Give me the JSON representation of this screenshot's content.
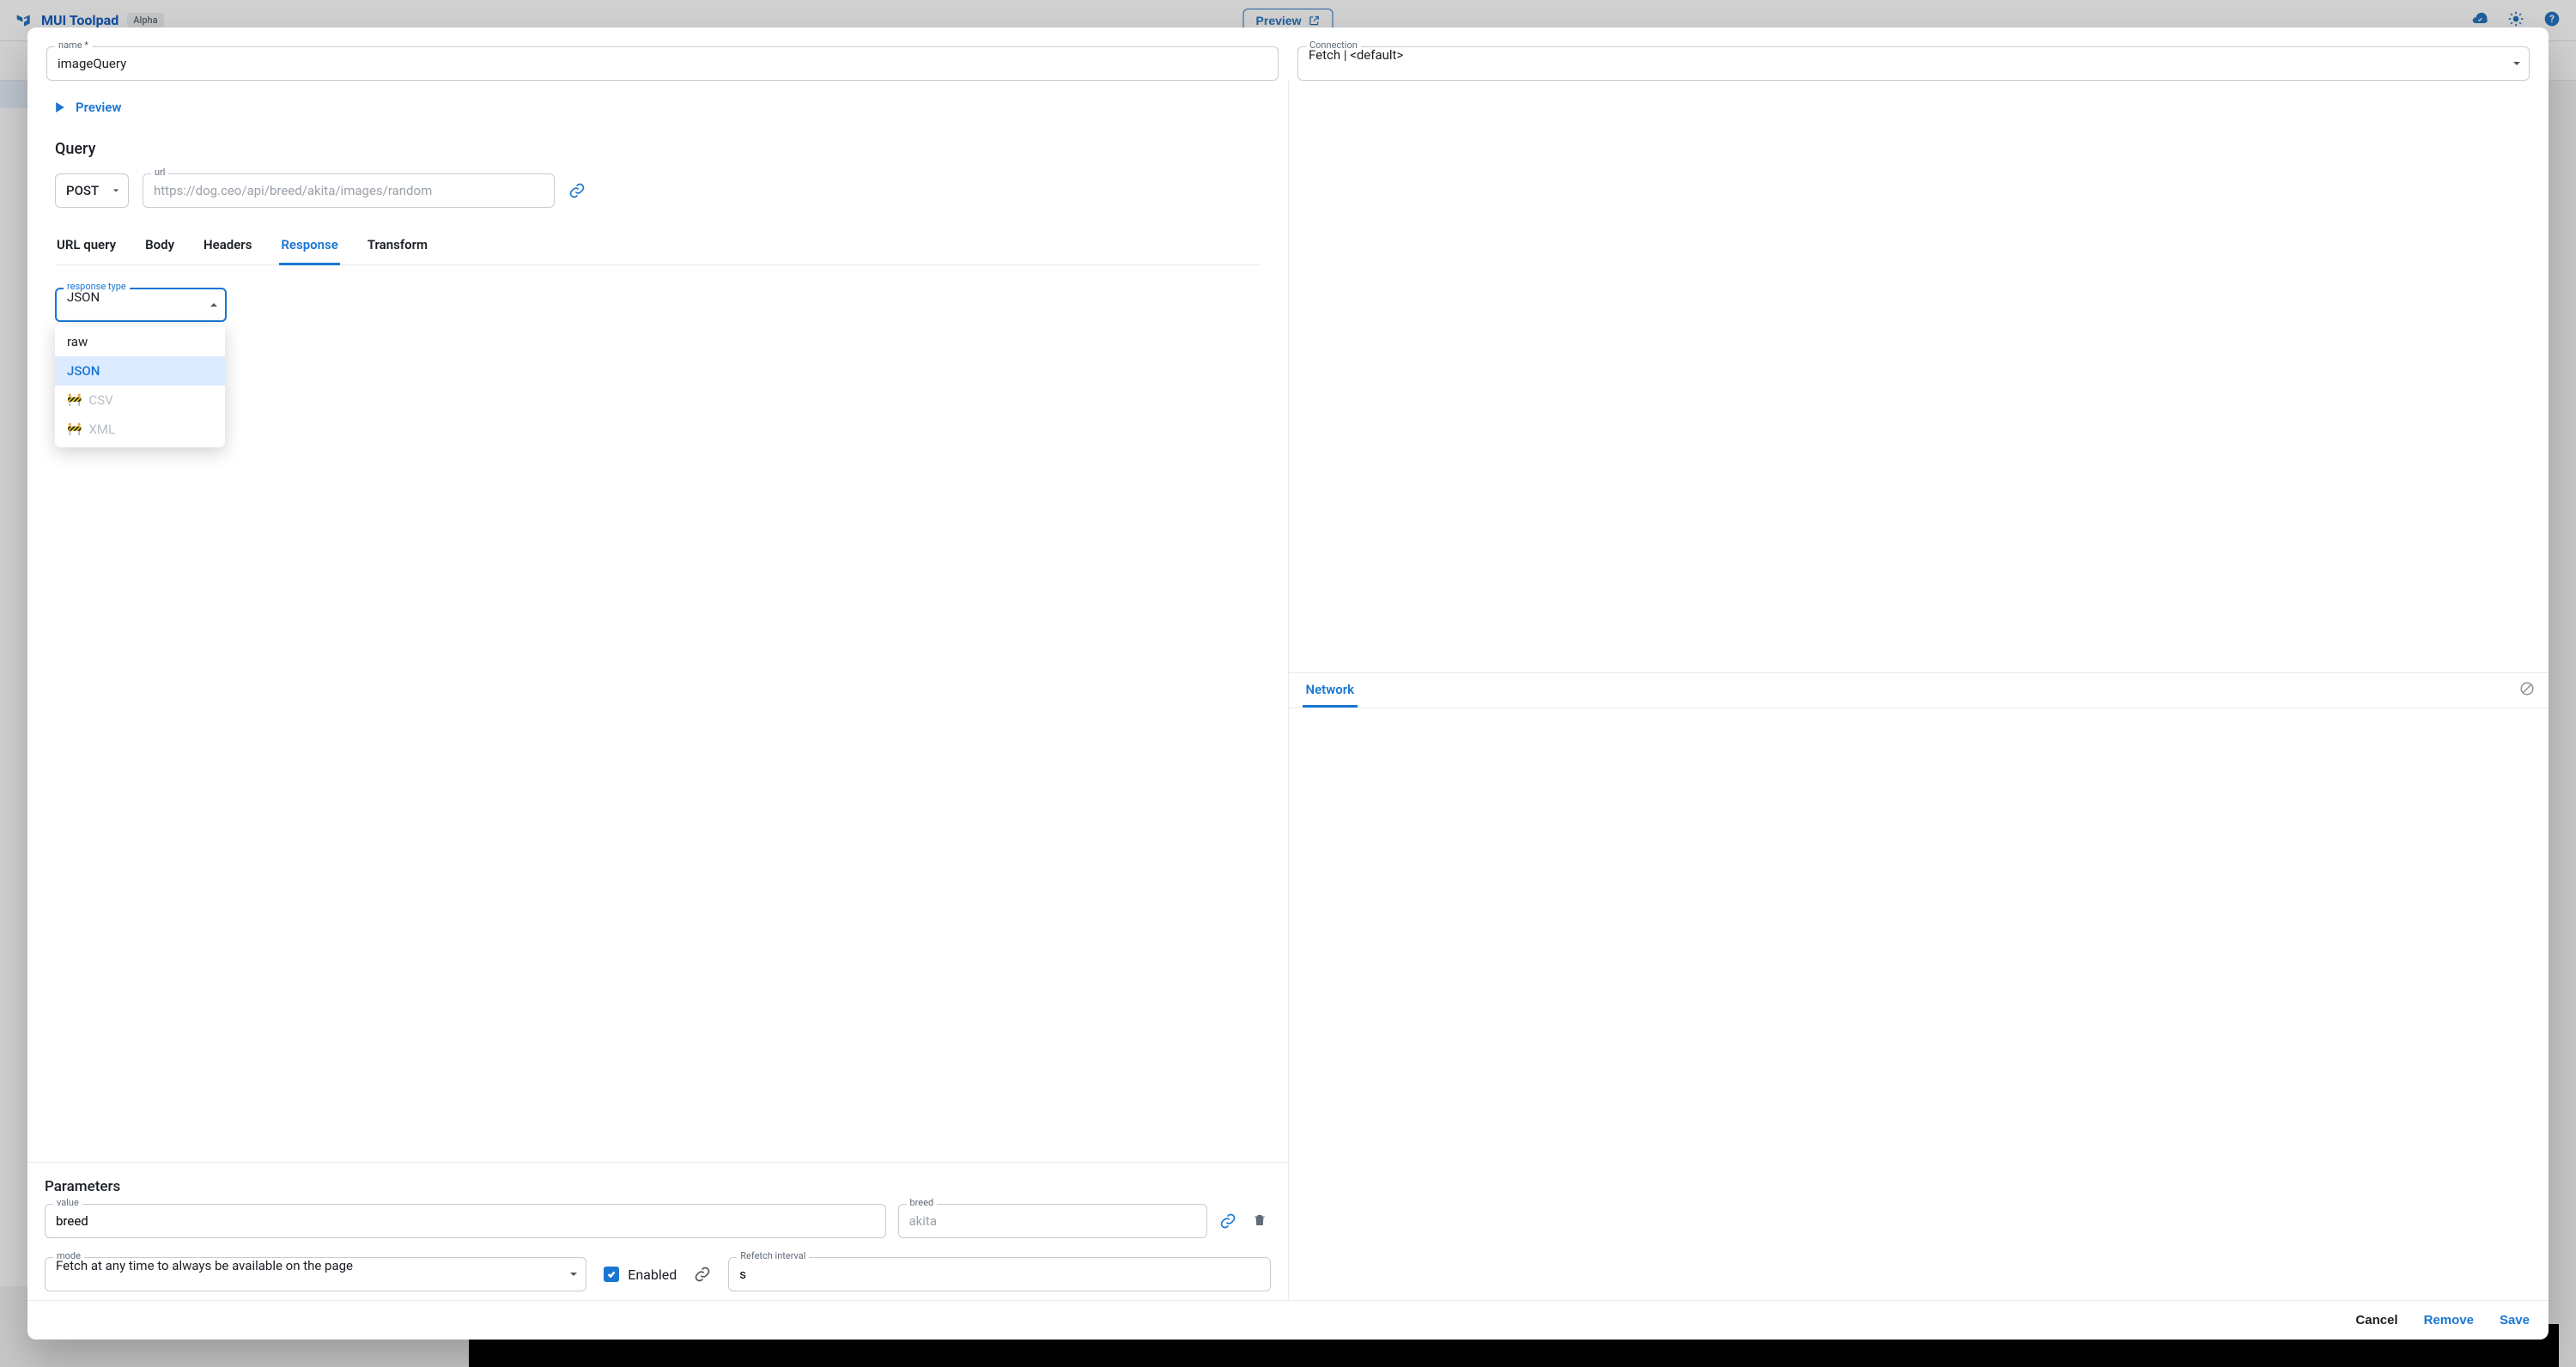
{
  "header": {
    "brand": "MUI Toolpad",
    "badge": "Alpha",
    "preview_button": "Preview"
  },
  "dialog": {
    "name_label": "name *",
    "name_value": "imageQuery",
    "connection_label": "Connection",
    "connection_value": "Fetch | <default>",
    "preview_toggle": "Preview",
    "query_heading": "Query",
    "method_value": "POST",
    "url_label": "url",
    "url_placeholder": "https://dog.ceo/api/breed/akita/images/random",
    "tabs": {
      "url_query": "URL query",
      "body": "Body",
      "headers": "Headers",
      "response": "Response",
      "transform": "Transform"
    },
    "response_type_label": "response type",
    "response_type_value": "JSON",
    "response_type_options": {
      "raw": "raw",
      "json": "JSON",
      "csv": "CSV",
      "xml": "XML"
    },
    "parameters_heading": "Parameters",
    "param_value_label": "value",
    "param_value": "breed",
    "param_breed_label": "breed",
    "param_breed_placeholder": "akita",
    "mode_label": "mode",
    "mode_value": "Fetch at any time to always be available on the page",
    "enabled_label": "Enabled",
    "refetch_label": "Refetch interval",
    "refetch_value": "s",
    "network_tab": "Network",
    "footer": {
      "cancel": "Cancel",
      "remove": "Remove",
      "save": "Save"
    }
  }
}
